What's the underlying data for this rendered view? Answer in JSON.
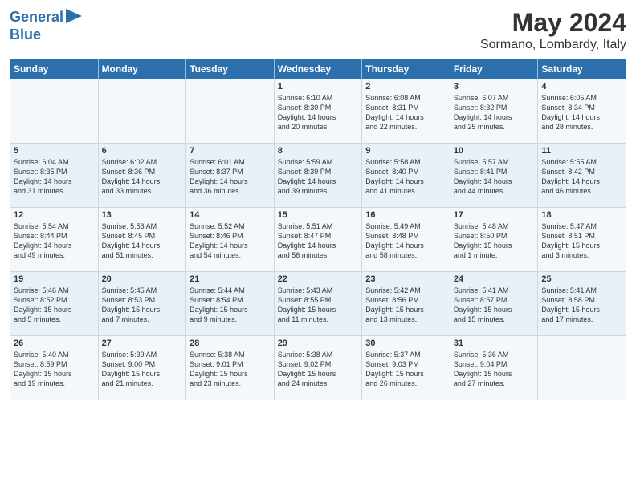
{
  "logo": {
    "line1": "General",
    "line2": "Blue"
  },
  "title": "May 2024",
  "subtitle": "Sormano, Lombardy, Italy",
  "days_of_week": [
    "Sunday",
    "Monday",
    "Tuesday",
    "Wednesday",
    "Thursday",
    "Friday",
    "Saturday"
  ],
  "weeks": [
    [
      {
        "day": "",
        "info": ""
      },
      {
        "day": "",
        "info": ""
      },
      {
        "day": "",
        "info": ""
      },
      {
        "day": "1",
        "info": "Sunrise: 6:10 AM\nSunset: 8:30 PM\nDaylight: 14 hours\nand 20 minutes."
      },
      {
        "day": "2",
        "info": "Sunrise: 6:08 AM\nSunset: 8:31 PM\nDaylight: 14 hours\nand 22 minutes."
      },
      {
        "day": "3",
        "info": "Sunrise: 6:07 AM\nSunset: 8:32 PM\nDaylight: 14 hours\nand 25 minutes."
      },
      {
        "day": "4",
        "info": "Sunrise: 6:05 AM\nSunset: 8:34 PM\nDaylight: 14 hours\nand 28 minutes."
      }
    ],
    [
      {
        "day": "5",
        "info": "Sunrise: 6:04 AM\nSunset: 8:35 PM\nDaylight: 14 hours\nand 31 minutes."
      },
      {
        "day": "6",
        "info": "Sunrise: 6:02 AM\nSunset: 8:36 PM\nDaylight: 14 hours\nand 33 minutes."
      },
      {
        "day": "7",
        "info": "Sunrise: 6:01 AM\nSunset: 8:37 PM\nDaylight: 14 hours\nand 36 minutes."
      },
      {
        "day": "8",
        "info": "Sunrise: 5:59 AM\nSunset: 8:39 PM\nDaylight: 14 hours\nand 39 minutes."
      },
      {
        "day": "9",
        "info": "Sunrise: 5:58 AM\nSunset: 8:40 PM\nDaylight: 14 hours\nand 41 minutes."
      },
      {
        "day": "10",
        "info": "Sunrise: 5:57 AM\nSunset: 8:41 PM\nDaylight: 14 hours\nand 44 minutes."
      },
      {
        "day": "11",
        "info": "Sunrise: 5:55 AM\nSunset: 8:42 PM\nDaylight: 14 hours\nand 46 minutes."
      }
    ],
    [
      {
        "day": "12",
        "info": "Sunrise: 5:54 AM\nSunset: 8:44 PM\nDaylight: 14 hours\nand 49 minutes."
      },
      {
        "day": "13",
        "info": "Sunrise: 5:53 AM\nSunset: 8:45 PM\nDaylight: 14 hours\nand 51 minutes."
      },
      {
        "day": "14",
        "info": "Sunrise: 5:52 AM\nSunset: 8:46 PM\nDaylight: 14 hours\nand 54 minutes."
      },
      {
        "day": "15",
        "info": "Sunrise: 5:51 AM\nSunset: 8:47 PM\nDaylight: 14 hours\nand 56 minutes."
      },
      {
        "day": "16",
        "info": "Sunrise: 5:49 AM\nSunset: 8:48 PM\nDaylight: 14 hours\nand 58 minutes."
      },
      {
        "day": "17",
        "info": "Sunrise: 5:48 AM\nSunset: 8:50 PM\nDaylight: 15 hours\nand 1 minute."
      },
      {
        "day": "18",
        "info": "Sunrise: 5:47 AM\nSunset: 8:51 PM\nDaylight: 15 hours\nand 3 minutes."
      }
    ],
    [
      {
        "day": "19",
        "info": "Sunrise: 5:46 AM\nSunset: 8:52 PM\nDaylight: 15 hours\nand 5 minutes."
      },
      {
        "day": "20",
        "info": "Sunrise: 5:45 AM\nSunset: 8:53 PM\nDaylight: 15 hours\nand 7 minutes."
      },
      {
        "day": "21",
        "info": "Sunrise: 5:44 AM\nSunset: 8:54 PM\nDaylight: 15 hours\nand 9 minutes."
      },
      {
        "day": "22",
        "info": "Sunrise: 5:43 AM\nSunset: 8:55 PM\nDaylight: 15 hours\nand 11 minutes."
      },
      {
        "day": "23",
        "info": "Sunrise: 5:42 AM\nSunset: 8:56 PM\nDaylight: 15 hours\nand 13 minutes."
      },
      {
        "day": "24",
        "info": "Sunrise: 5:41 AM\nSunset: 8:57 PM\nDaylight: 15 hours\nand 15 minutes."
      },
      {
        "day": "25",
        "info": "Sunrise: 5:41 AM\nSunset: 8:58 PM\nDaylight: 15 hours\nand 17 minutes."
      }
    ],
    [
      {
        "day": "26",
        "info": "Sunrise: 5:40 AM\nSunset: 8:59 PM\nDaylight: 15 hours\nand 19 minutes."
      },
      {
        "day": "27",
        "info": "Sunrise: 5:39 AM\nSunset: 9:00 PM\nDaylight: 15 hours\nand 21 minutes."
      },
      {
        "day": "28",
        "info": "Sunrise: 5:38 AM\nSunset: 9:01 PM\nDaylight: 15 hours\nand 23 minutes."
      },
      {
        "day": "29",
        "info": "Sunrise: 5:38 AM\nSunset: 9:02 PM\nDaylight: 15 hours\nand 24 minutes."
      },
      {
        "day": "30",
        "info": "Sunrise: 5:37 AM\nSunset: 9:03 PM\nDaylight: 15 hours\nand 26 minutes."
      },
      {
        "day": "31",
        "info": "Sunrise: 5:36 AM\nSunset: 9:04 PM\nDaylight: 15 hours\nand 27 minutes."
      },
      {
        "day": "",
        "info": ""
      }
    ]
  ]
}
